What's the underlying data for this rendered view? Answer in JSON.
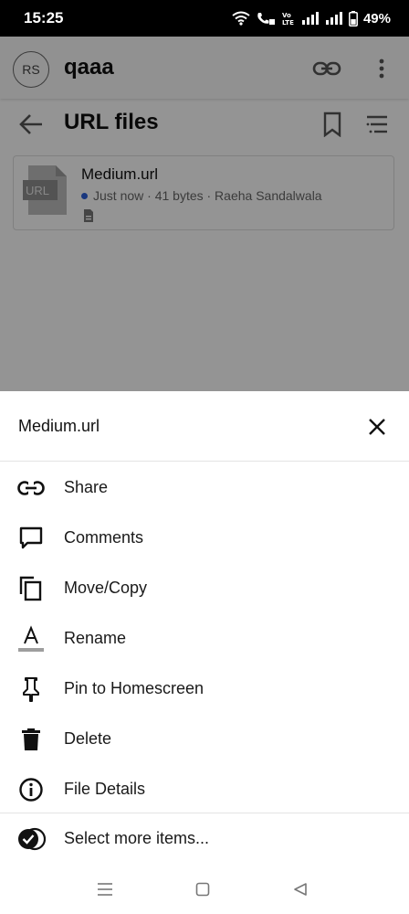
{
  "status_bar": {
    "time": "15:25",
    "battery": "49%",
    "volte_label": "Vo LTE"
  },
  "app": {
    "avatar_initials": "RS",
    "space_name": "qaaa",
    "folder_title": "URL files",
    "file": {
      "thumb_label": "URL",
      "name": "Medium.url",
      "meta": "Just now · 41 bytes · Raeha Sandalwala"
    }
  },
  "sheet": {
    "title": "Medium.url",
    "items": [
      {
        "label": "Share",
        "icon": "link-icon"
      },
      {
        "label": "Comments",
        "icon": "comment-icon"
      },
      {
        "label": "Move/Copy",
        "icon": "copy-icon"
      },
      {
        "label": "Rename",
        "icon": "rename-icon"
      },
      {
        "label": "Pin to Homescreen",
        "icon": "pin-icon"
      },
      {
        "label": "Delete",
        "icon": "trash-icon"
      },
      {
        "label": "File Details",
        "icon": "info-icon"
      }
    ],
    "select_more": {
      "label": "Select more items...",
      "icon": "check-circle-icon"
    }
  },
  "colors": {
    "accent_dot": "#2b5fd9",
    "overlay": "rgba(0,0,0,0.42)"
  }
}
